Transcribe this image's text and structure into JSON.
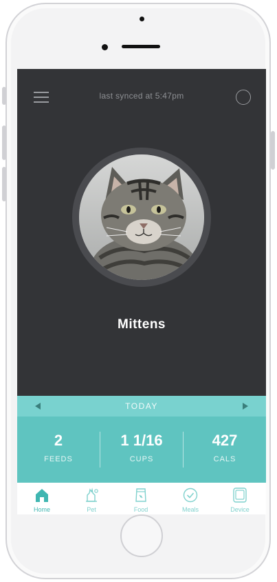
{
  "header": {
    "sync_text": "last synced at 5:47pm"
  },
  "pet": {
    "name": "Mittens"
  },
  "date_nav": {
    "label": "TODAY"
  },
  "stats": [
    {
      "value": "2",
      "label": "FEEDS"
    },
    {
      "value": "1 1/16",
      "label": "CUPS"
    },
    {
      "value": "427",
      "label": "CALS"
    }
  ],
  "tabs": [
    {
      "label": "Home",
      "icon": "home-icon",
      "active": true
    },
    {
      "label": "Pet",
      "icon": "pet-icon",
      "active": false
    },
    {
      "label": "Food",
      "icon": "food-bag-icon",
      "active": false
    },
    {
      "label": "Meals",
      "icon": "meals-check-icon",
      "active": false
    },
    {
      "label": "Device",
      "icon": "device-icon",
      "active": false
    }
  ],
  "colors": {
    "screen_bg": "#333437",
    "date_bar": "#79d2cf",
    "stats_bg": "#5fc4c0",
    "accent": "#3fb6b1",
    "tab_label": "#7fd1cd"
  }
}
